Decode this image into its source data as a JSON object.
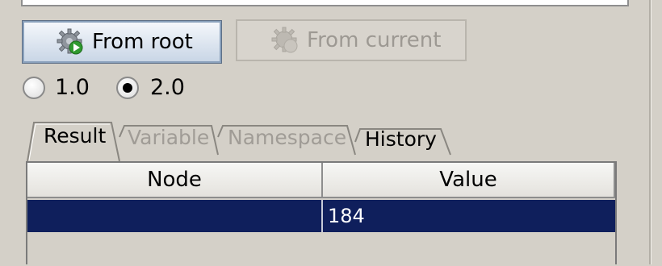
{
  "toolbar": {
    "from_root_label": "From root",
    "from_current_label": "From current",
    "from_root_icon": "gear-run-icon",
    "from_current_icon": "gear-run-icon"
  },
  "version": {
    "options": [
      "1.0",
      "2.0"
    ],
    "selected": "2.0"
  },
  "tabs": [
    {
      "label": "Result",
      "active": true,
      "enabled": true
    },
    {
      "label": "Variable",
      "active": false,
      "enabled": false
    },
    {
      "label": "Namespace",
      "active": false,
      "enabled": false
    },
    {
      "label": "History",
      "active": false,
      "enabled": true
    }
  ],
  "results": {
    "columns": [
      "Node",
      "Value"
    ],
    "rows": [
      {
        "node": "",
        "value": "184",
        "selected": true
      }
    ]
  },
  "colors": {
    "selection": "#0f1f5c",
    "window_bg": "#d4d0c8",
    "disabled_text": "#a09c96"
  }
}
